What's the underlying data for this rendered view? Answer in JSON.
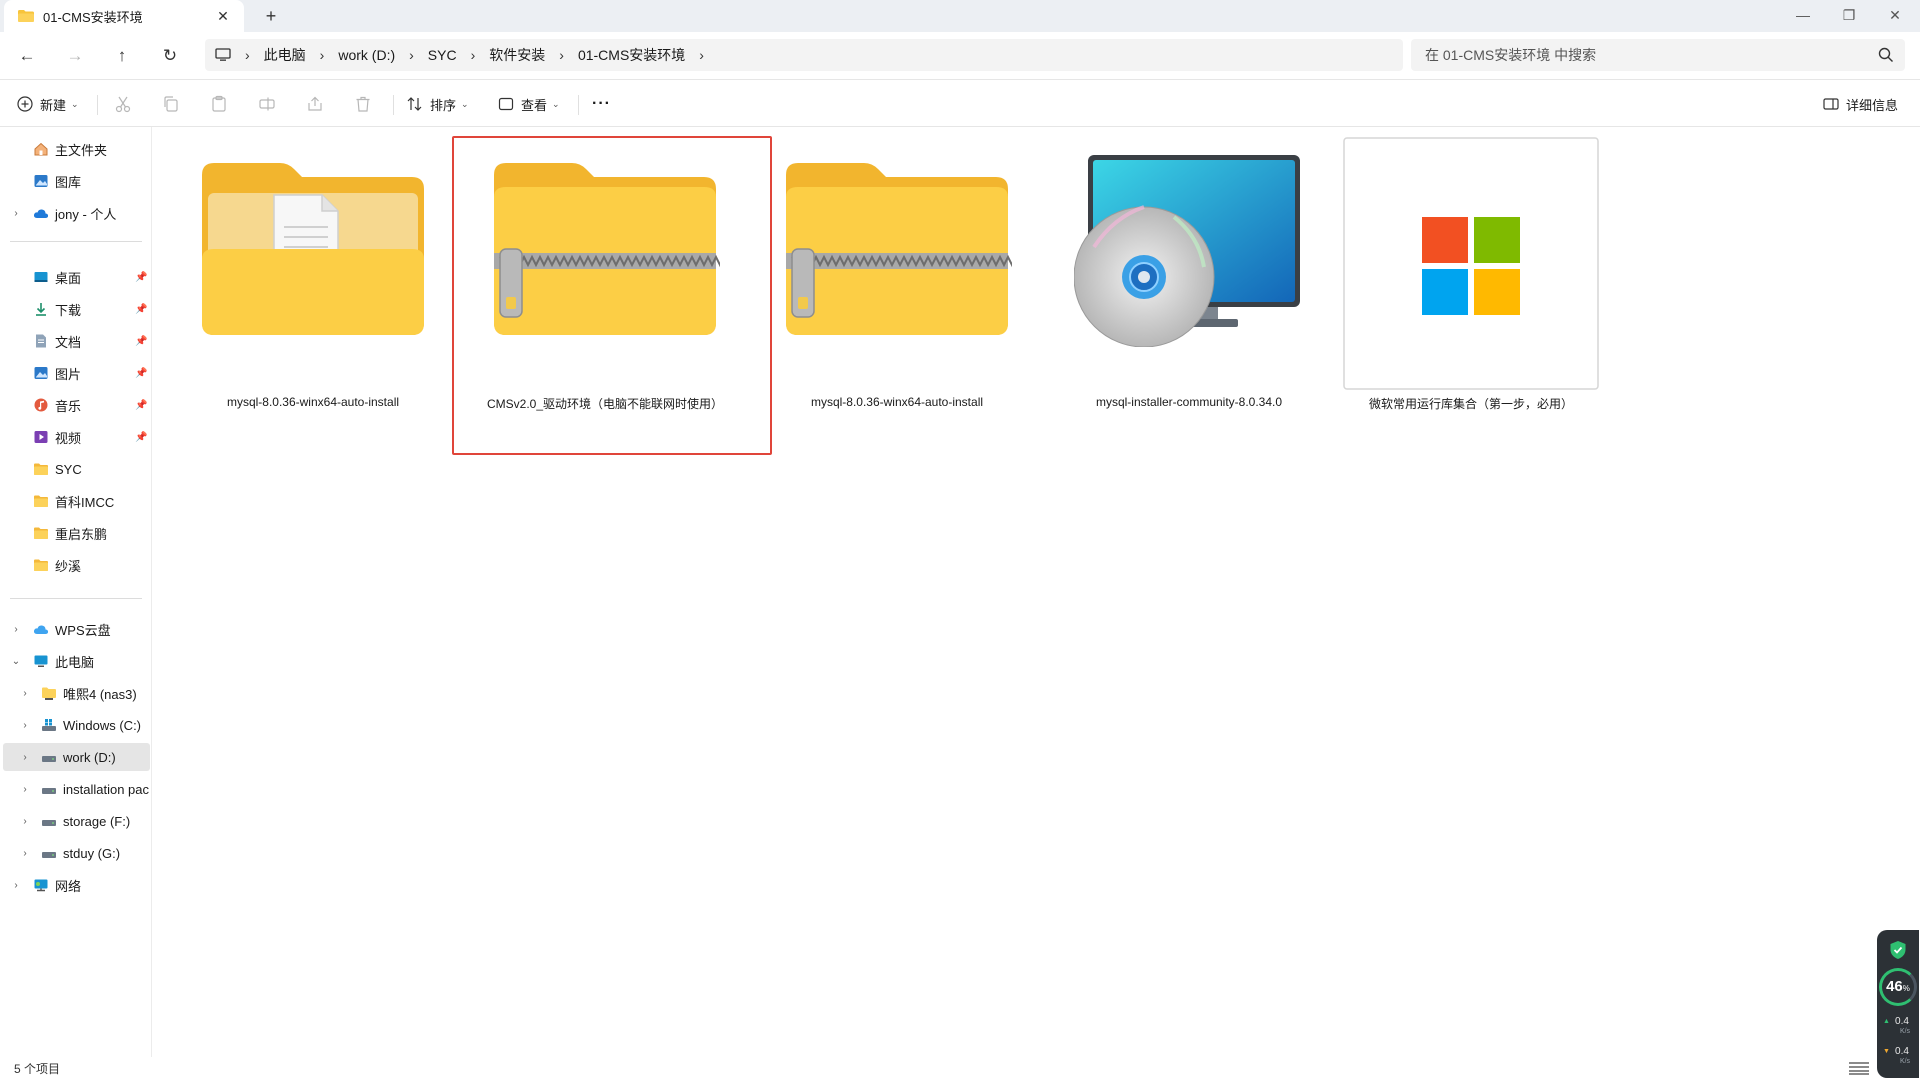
{
  "window": {
    "tab_title": "01-CMS安装环境",
    "tab_close": "✕",
    "new_tab": "+",
    "minimize": "—",
    "maximize": "❐",
    "close": "✕"
  },
  "address": {
    "crumbs": [
      "此电脑",
      "work (D:)",
      "SYC",
      "软件安装",
      "01-CMS安装环境"
    ],
    "search_placeholder": "在 01-CMS安装环境 中搜索"
  },
  "toolbar": {
    "new_label": "新建",
    "sort_label": "排序",
    "view_label": "查看",
    "more_label": "···",
    "details_label": "详细信息"
  },
  "sidebar": {
    "quick": [
      {
        "label": "主文件夹",
        "icon": "home-icon"
      },
      {
        "label": "图库",
        "icon": "gallery-icon"
      },
      {
        "label": "jony - 个人",
        "icon": "cloud-icon"
      }
    ],
    "pinned": [
      {
        "label": "桌面",
        "icon": "desktop-icon"
      },
      {
        "label": "下载",
        "icon": "download-icon"
      },
      {
        "label": "文档",
        "icon": "document-icon"
      },
      {
        "label": "图片",
        "icon": "pictures-icon"
      },
      {
        "label": "音乐",
        "icon": "music-icon"
      },
      {
        "label": "视频",
        "icon": "video-icon"
      },
      {
        "label": "SYC",
        "icon": "folder-icon"
      },
      {
        "label": "首科IMCC",
        "icon": "folder-icon"
      },
      {
        "label": "重启东鹏",
        "icon": "folder-icon"
      },
      {
        "label": "纱溪",
        "icon": "folder-icon"
      }
    ],
    "tree": [
      {
        "label": "WPS云盘",
        "icon": "wps-cloud-icon"
      },
      {
        "label": "此电脑",
        "icon": "computer-icon"
      },
      {
        "label": "唯熙4 (nas3)",
        "icon": "network-drive-icon"
      },
      {
        "label": "Windows (C:)",
        "icon": "windows-drive-icon"
      },
      {
        "label": "work (D:)",
        "icon": "drive-icon"
      },
      {
        "label": "installation pac",
        "icon": "drive-icon"
      },
      {
        "label": "storage (F:)",
        "icon": "drive-icon"
      },
      {
        "label": "stduy (G:)",
        "icon": "drive-icon"
      },
      {
        "label": "网络",
        "icon": "network-icon"
      }
    ]
  },
  "files": [
    {
      "name": "mysql-8.0.36-winx64-auto-install",
      "icon": "folder-document-icon"
    },
    {
      "name": "CMSv2.0_驱动环境（电脑不能联网时使用）",
      "icon": "zip-folder-icon"
    },
    {
      "name": "mysql-8.0.36-winx64-auto-install",
      "icon": "zip-folder-icon"
    },
    {
      "name": "mysql-installer-community-8.0.34.0",
      "icon": "installer-disc-icon"
    },
    {
      "name": "微软常用运行库集合（第一步，必用）",
      "icon": "microsoft-logo-icon"
    }
  ],
  "status": {
    "item_count": "5 个项目"
  },
  "widget": {
    "percent": "46",
    "percent_sign": "%",
    "up_speed": "0.4",
    "up_unit": "K/s",
    "down_speed": "0.4",
    "down_unit": "K/s"
  },
  "colors": {
    "highlight_border": "#e0453a",
    "folder_yellow": "#f7c43c",
    "accent": "#0067c0"
  }
}
